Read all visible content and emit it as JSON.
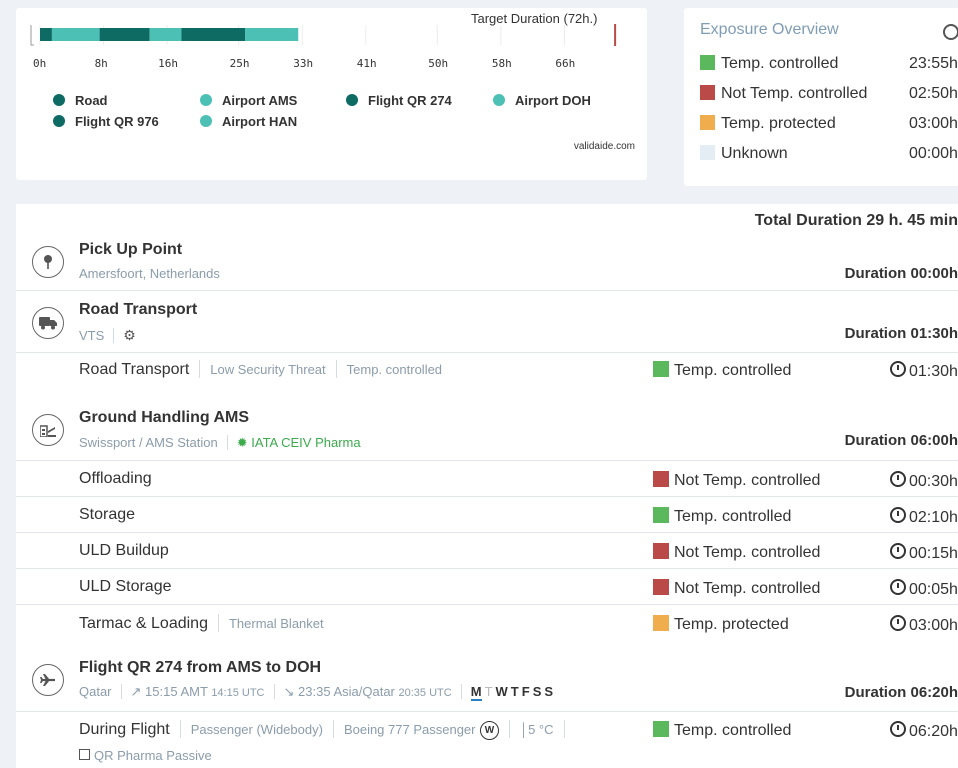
{
  "colors": {
    "road": "#0e6b64",
    "airport": "#4dc0b5",
    "temp_controlled": "#5cb85c",
    "not_temp_controlled": "#b94a48",
    "temp_protected": "#f0ad4e",
    "unknown": "#e4edf3",
    "target": "#b94a48"
  },
  "timeline": {
    "target_label": "Target Duration (72h.)",
    "axis_ticks": [
      "0h",
      "8h",
      "16h",
      "25h",
      "33h",
      "41h",
      "50h",
      "58h",
      "66h"
    ],
    "segments": [
      {
        "type": "road",
        "start_h": 0,
        "end_h": 1.5
      },
      {
        "type": "airport",
        "start_h": 1.5,
        "end_h": 7.5
      },
      {
        "type": "road",
        "start_h": 7.5,
        "end_h": 13.8
      },
      {
        "type": "airport",
        "start_h": 13.8,
        "end_h": 17.8
      },
      {
        "type": "road",
        "start_h": 17.8,
        "end_h": 25.8
      },
      {
        "type": "airport",
        "start_h": 25.8,
        "end_h": 32.5
      }
    ],
    "max_h": 74,
    "target_h": 72,
    "legend": [
      {
        "label": "Road",
        "color": "#0e6b64"
      },
      {
        "label": "Airport AMS",
        "color": "#4dc0b5"
      },
      {
        "label": "Flight QR 274",
        "color": "#0e6b64"
      },
      {
        "label": "Airport DOH",
        "color": "#4dc0b5"
      },
      {
        "label": "Flight QR 976",
        "color": "#0e6b64"
      },
      {
        "label": "Airport HAN",
        "color": "#4dc0b5"
      }
    ],
    "watermark": "validaide.com"
  },
  "exposure": {
    "title": "Exposure Overview",
    "rows": [
      {
        "label": "Temp. controlled",
        "time": "23:55h",
        "color": "#5cb85c"
      },
      {
        "label": "Not Temp. controlled",
        "time": "02:50h",
        "color": "#b94a48"
      },
      {
        "label": "Temp. protected",
        "time": "03:00h",
        "color": "#f0ad4e"
      },
      {
        "label": "Unknown",
        "time": "00:00h",
        "color": "#e4edf3"
      }
    ]
  },
  "total_duration": "Total Duration 29 h. 45 min",
  "pickup": {
    "title": "Pick Up Point",
    "location": "Amersfoort, Netherlands",
    "duration": "Duration 00:00h"
  },
  "road": {
    "title": "Road Transport",
    "provider": "VTS",
    "duration": "Duration 01:30h",
    "row": {
      "name": "Road Transport",
      "tags": [
        "Low Security Threat",
        "Temp. controlled"
      ],
      "status": "Temp. controlled",
      "status_color": "#5cb85c",
      "time": "01:30h"
    }
  },
  "ground": {
    "title": "Ground Handling AMS",
    "provider": "Swissport / AMS Station",
    "cert": "IATA CEIV Pharma",
    "duration": "Duration 06:00h",
    "rows": [
      {
        "name": "Offloading",
        "tag": "",
        "status": "Not Temp. controlled",
        "status_color": "#b94a48",
        "time": "00:30h"
      },
      {
        "name": "Storage",
        "tag": "",
        "status": "Temp. controlled",
        "status_color": "#5cb85c",
        "time": "02:10h"
      },
      {
        "name": "ULD Buildup",
        "tag": "",
        "status": "Not Temp. controlled",
        "status_color": "#b94a48",
        "time": "00:15h"
      },
      {
        "name": "ULD Storage",
        "tag": "",
        "status": "Not Temp. controlled",
        "status_color": "#b94a48",
        "time": "00:05h"
      },
      {
        "name": "Tarmac & Loading",
        "tag": "Thermal Blanket",
        "status": "Temp. protected",
        "status_color": "#f0ad4e",
        "time": "03:00h"
      }
    ]
  },
  "flight": {
    "title": "Flight QR 274 from AMS to DOH",
    "airline": "Qatar",
    "departure": "15:15 AMT",
    "departure_utc": "14:15 UTC",
    "arrival": "23:35 Asia/Qatar",
    "arrival_utc": "20:35 UTC",
    "days": [
      "M",
      "T",
      "W",
      "T",
      "F",
      "S",
      "S"
    ],
    "duration": "Duration 06:20h",
    "row": {
      "name": "During Flight",
      "tags": [
        "Passenger (Widebody)",
        "Boeing 777 Passenger"
      ],
      "temp": "5 °C",
      "extra": "QR Pharma Passive",
      "status": "Temp. controlled",
      "status_color": "#5cb85c",
      "time": "06:20h"
    }
  }
}
